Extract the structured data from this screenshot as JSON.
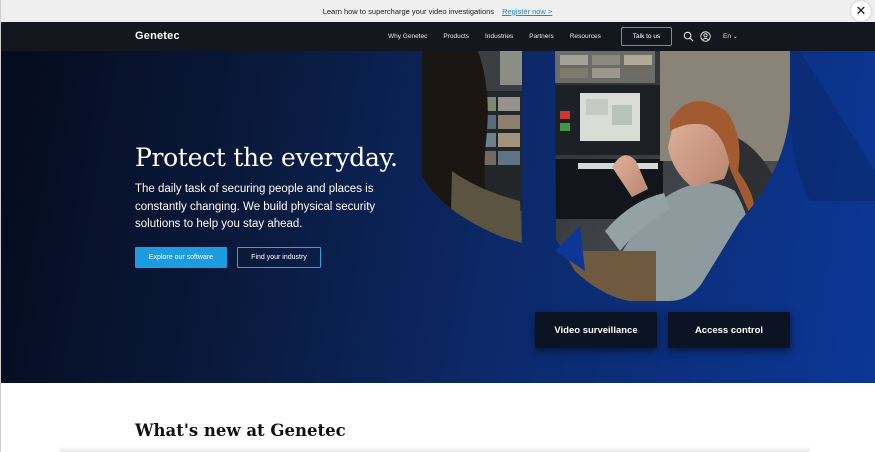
{
  "announcement": {
    "text": "Learn how to supercharge your video investigations",
    "link": "Register now >",
    "close_icon": "close-icon"
  },
  "nav": {
    "logo": "Genetec",
    "links": [
      "Why Genetec",
      "Products",
      "Industries",
      "Partners",
      "Resources"
    ],
    "cta": "Talk to us",
    "search_icon": "search-icon",
    "account_icon": "user-account-icon",
    "language": "En"
  },
  "hero": {
    "title": "Protect the everyday.",
    "subtitle": "The daily task of securing people and places is constantly changing. We build physical security solutions to help you stay ahead.",
    "primary_button": "Explore our software",
    "secondary_button": "Find your industry",
    "categories": [
      "Video surveillance",
      "Access control"
    ]
  },
  "section": {
    "title": "What's new at Genetec"
  },
  "colors": {
    "accent": "#1c9be0",
    "nav_bg": "#14171d",
    "hero_dark": "#050b1d",
    "hero_blue": "#0c3796"
  }
}
